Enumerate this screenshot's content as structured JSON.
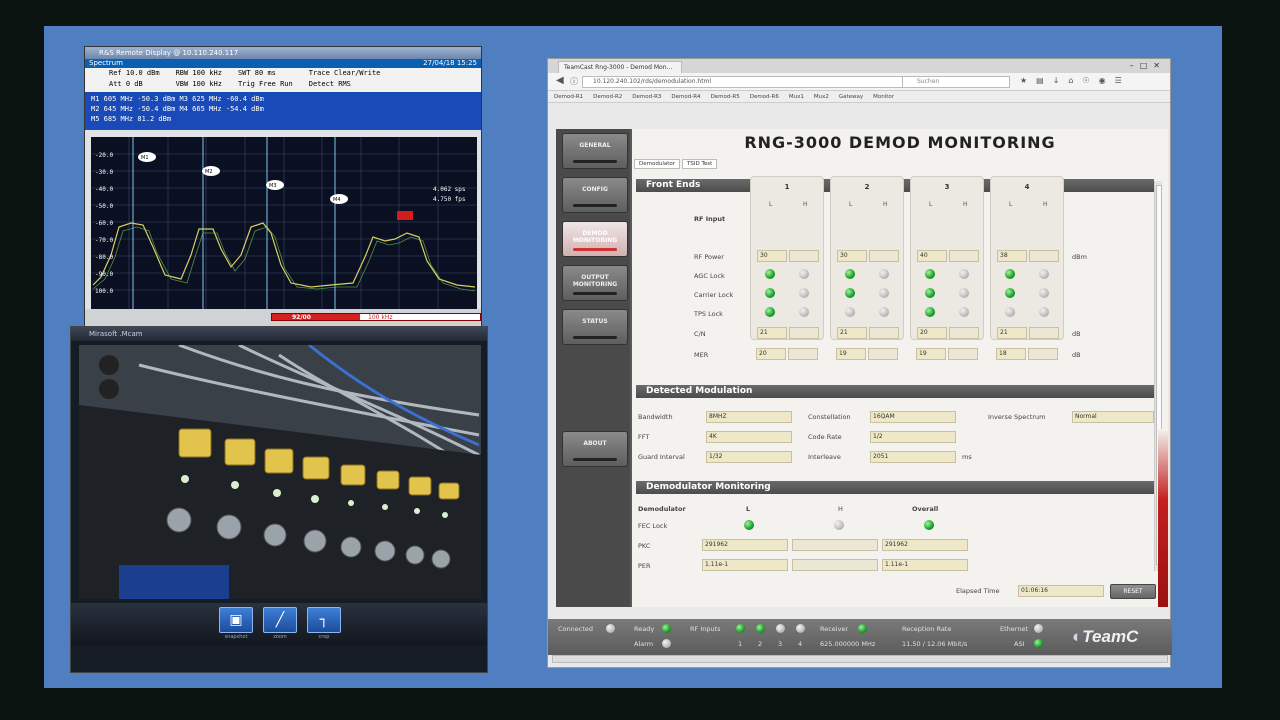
{
  "spectrum": {
    "title": "R&S Remote Display @ 10.110.240.117",
    "menu_left": "Spectrum",
    "menu_right": "27/04/18 15:25",
    "ref": "Ref  10.0 dBm",
    "att": "Att  0 dB",
    "rbw": "RBW  100 kHz",
    "vbw": "VBW  100 kHz",
    "swt": "SWT  80 ms",
    "trg": "Trig  Free Run",
    "trace": "Trace  Clear/Write",
    "detect": "Detect  RMS",
    "marker_rows": [
      "M1   605 MHz  -50.3 dBm      M3   625 MHz  -60.4 dBm",
      "M2   645 MHz  -50.4 dBm      M4   665 MHz  -54.4 dBm",
      "M5   685 MHz  81.2 dBm"
    ],
    "y_ticks": [
      "-20.0",
      "-30.0",
      "-40.0",
      "-50.0",
      "-60.0",
      "-70.0",
      "-80.0",
      "-90.0",
      "100.0"
    ],
    "readout": [
      "4.062 sps",
      "4.750 fps"
    ],
    "status_left": "92/00",
    "status_right": "100 kHz",
    "markers": [
      "M1",
      "M2",
      "M3",
      "M4"
    ]
  },
  "camera": {
    "title": "Mirasoft .Mcam",
    "buttons": [
      {
        "glyph": "▣",
        "label": "snapshot"
      },
      {
        "glyph": "╱",
        "label": "zoom"
      },
      {
        "glyph": "┐",
        "label": "crop"
      }
    ],
    "colors": {
      "panel": "#1b1e22",
      "button_yellow": "#e7c64a"
    }
  },
  "browser": {
    "tab_title": "TeamCast Rng-3000 - Demod Mon...",
    "url": "10.120.240.102/rds/demodulation.html",
    "search_placeholder": "Suchen",
    "bookmarks": [
      "Demod-R1",
      "Demod-R2",
      "Demod-R3",
      "Demod-R4",
      "Demod-R5",
      "Demod-R6",
      "Mux1",
      "Mux2",
      "Gateway",
      "Monitor"
    ]
  },
  "app": {
    "heading": "RNG-3000 DEMOD MONITORING",
    "nav": [
      {
        "label": "GENERAL",
        "active": false
      },
      {
        "label": "CONFIG",
        "active": false
      },
      {
        "label": "DEMOD MONITORING",
        "active": true
      },
      {
        "label": "OUTPUT MONITORING",
        "active": false
      },
      {
        "label": "STATUS",
        "active": false
      },
      {
        "label": "ABOUT",
        "active": false
      }
    ],
    "subtabs": [
      "Demodulator",
      "TSID Test"
    ],
    "front_ends": {
      "title": "Front Ends",
      "rf_input_label": "RF Input",
      "row_labels": [
        "RF Power",
        "AGC Lock",
        "Carrier Lock",
        "TPS Lock",
        "C/N",
        "MER"
      ],
      "units": {
        "rf_power": "dBm",
        "cn": "dB",
        "mer": "dB"
      },
      "channels": [
        {
          "num": "1",
          "rf_power": "30",
          "cn": "21",
          "mer": "20",
          "tps_gray": false
        },
        {
          "num": "2",
          "rf_power": "30",
          "cn": "21",
          "mer": "19",
          "tps_gray": true
        },
        {
          "num": "3",
          "rf_power": "40",
          "cn": "20",
          "mer": "19",
          "tps_gray": false
        },
        {
          "num": "4",
          "rf_power": "38",
          "cn": "21",
          "mer": "18",
          "tps_gray": true
        }
      ],
      "l": "L",
      "h": "H"
    },
    "detected": {
      "title": "Detected Modulation",
      "bandwidth_label": "Bandwidth",
      "bandwidth": "8MHZ",
      "fft_label": "FFT",
      "fft": "4K",
      "guard_label": "Guard Interval",
      "guard": "1/32",
      "constellation_label": "Constellation",
      "constellation": "16QAM",
      "code_rate_label": "Code Rate",
      "code_rate": "1/2",
      "interleave_label": "Interleave",
      "interleave": "2051",
      "interleave_unit": "ms",
      "inverse_label": "Inverse Spectrum",
      "inverse": "Normal"
    },
    "demod_mon": {
      "title": "Demodulator Monitoring",
      "col_demod": "Demodulator",
      "col_l": "L",
      "col_h": "H",
      "col_overall": "Overall",
      "fec_label": "FEC Lock",
      "pkc_label": "PKC",
      "pkc_l": "291962",
      "pkc_overall": "291962",
      "per_label": "PER",
      "per_l": "1.11e-1",
      "per_overall": "1.11e-1",
      "elapsed_label": "Elapsed Time",
      "elapsed": "01:06:16",
      "reset": "RESET"
    },
    "status_bar": {
      "connected": "Connected",
      "ready": "Ready",
      "alarm": "Alarm",
      "rf_inputs": "RF Inputs",
      "rf_nums": [
        "1",
        "2",
        "3",
        "4"
      ],
      "receiver": "Receiver",
      "freq": "625.000000 MHz",
      "reception_rate": "Reception Rate",
      "rate": "11.50 / 12.06 Mbit/s",
      "ethernet": "Ethernet",
      "asi": "ASI",
      "brand": "TeamC"
    }
  }
}
